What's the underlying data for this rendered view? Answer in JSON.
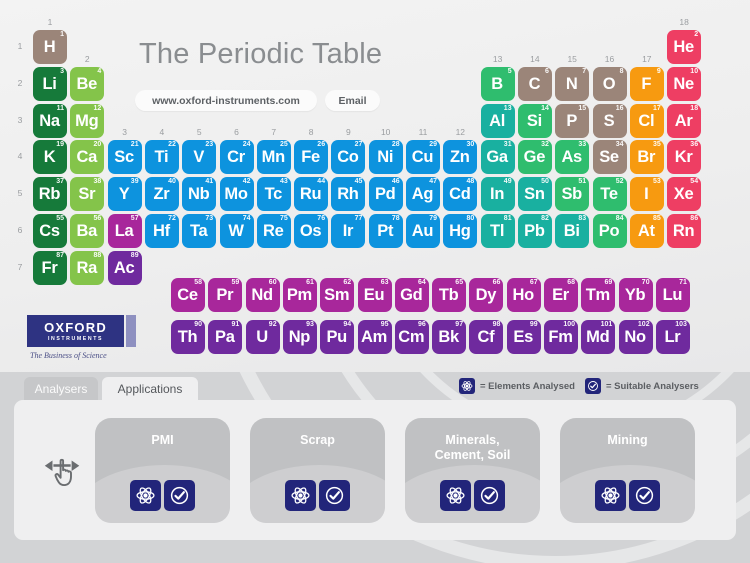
{
  "header": {
    "title": "The Periodic Table",
    "website_button": "www.oxford-instruments.com",
    "email_button": "Email"
  },
  "logo": {
    "line1": "OXFORD",
    "line2": "INSTRUMENTS",
    "tagline": "The Business of Science"
  },
  "tabs": [
    {
      "label": "Analysers",
      "active": false
    },
    {
      "label": "Applications",
      "active": true
    }
  ],
  "legend": [
    {
      "icon": "atom-icon",
      "text": "= Elements Analysed"
    },
    {
      "icon": "check-circle-icon",
      "text": "= Suitable Analysers"
    }
  ],
  "applications": [
    {
      "title": "PMI",
      "icons": [
        "atom-icon",
        "check-circle-icon"
      ]
    },
    {
      "title": "Scrap",
      "icons": [
        "atom-icon",
        "check-circle-icon"
      ]
    },
    {
      "title": "Minerals,\nCement, Soil",
      "icons": [
        "atom-icon",
        "check-circle-icon"
      ]
    },
    {
      "title": "Mining",
      "icons": [
        "atom-icon",
        "check-circle-icon"
      ]
    }
  ],
  "swipe_hint_icon": "swipe-horizontal-icon",
  "group_labels": [
    "1",
    "2",
    "3",
    "4",
    "5",
    "6",
    "7",
    "8",
    "9",
    "10",
    "11",
    "12",
    "13",
    "14",
    "15",
    "16",
    "17",
    "18"
  ],
  "period_labels": [
    "1",
    "2",
    "3",
    "4",
    "5",
    "6",
    "7"
  ],
  "colors": {
    "alkali": "#167a3a",
    "alkaline_earth": "#84c44a",
    "hydrogen": "#9b8579",
    "transition": "#0d93de",
    "post_transition": "#19b0a0",
    "metalloid": "#2fbd6e",
    "nonmetal": "#9b8579",
    "halogen": "#f79a10",
    "noble": "#ee3e63",
    "lanthanide": "#a8279b",
    "actinide": "#6f2a9e",
    "brand_navy": "#22257a"
  },
  "elements": [
    {
      "sym": "H",
      "num": "1",
      "g": 1,
      "p": 1,
      "c": "hydrogen"
    },
    {
      "sym": "He",
      "num": "2",
      "g": 18,
      "p": 1,
      "c": "noble"
    },
    {
      "sym": "Li",
      "num": "3",
      "g": 1,
      "p": 2,
      "c": "alkali"
    },
    {
      "sym": "Be",
      "num": "4",
      "g": 2,
      "p": 2,
      "c": "alkaline_earth"
    },
    {
      "sym": "B",
      "num": "5",
      "g": 13,
      "p": 2,
      "c": "metalloid"
    },
    {
      "sym": "C",
      "num": "6",
      "g": 14,
      "p": 2,
      "c": "nonmetal"
    },
    {
      "sym": "N",
      "num": "7",
      "g": 15,
      "p": 2,
      "c": "nonmetal"
    },
    {
      "sym": "O",
      "num": "8",
      "g": 16,
      "p": 2,
      "c": "nonmetal"
    },
    {
      "sym": "F",
      "num": "9",
      "g": 17,
      "p": 2,
      "c": "halogen"
    },
    {
      "sym": "Ne",
      "num": "10",
      "g": 18,
      "p": 2,
      "c": "noble"
    },
    {
      "sym": "Na",
      "num": "11",
      "g": 1,
      "p": 3,
      "c": "alkali"
    },
    {
      "sym": "Mg",
      "num": "12",
      "g": 2,
      "p": 3,
      "c": "alkaline_earth"
    },
    {
      "sym": "Al",
      "num": "13",
      "g": 13,
      "p": 3,
      "c": "post_transition"
    },
    {
      "sym": "Si",
      "num": "14",
      "g": 14,
      "p": 3,
      "c": "metalloid"
    },
    {
      "sym": "P",
      "num": "15",
      "g": 15,
      "p": 3,
      "c": "nonmetal"
    },
    {
      "sym": "S",
      "num": "16",
      "g": 16,
      "p": 3,
      "c": "nonmetal"
    },
    {
      "sym": "Cl",
      "num": "17",
      "g": 17,
      "p": 3,
      "c": "halogen"
    },
    {
      "sym": "Ar",
      "num": "18",
      "g": 18,
      "p": 3,
      "c": "noble"
    },
    {
      "sym": "K",
      "num": "19",
      "g": 1,
      "p": 4,
      "c": "alkali"
    },
    {
      "sym": "Ca",
      "num": "20",
      "g": 2,
      "p": 4,
      "c": "alkaline_earth"
    },
    {
      "sym": "Sc",
      "num": "21",
      "g": 3,
      "p": 4,
      "c": "transition"
    },
    {
      "sym": "Ti",
      "num": "22",
      "g": 4,
      "p": 4,
      "c": "transition"
    },
    {
      "sym": "V",
      "num": "23",
      "g": 5,
      "p": 4,
      "c": "transition"
    },
    {
      "sym": "Cr",
      "num": "24",
      "g": 6,
      "p": 4,
      "c": "transition"
    },
    {
      "sym": "Mn",
      "num": "25",
      "g": 7,
      "p": 4,
      "c": "transition"
    },
    {
      "sym": "Fe",
      "num": "26",
      "g": 8,
      "p": 4,
      "c": "transition"
    },
    {
      "sym": "Co",
      "num": "27",
      "g": 9,
      "p": 4,
      "c": "transition"
    },
    {
      "sym": "Ni",
      "num": "28",
      "g": 10,
      "p": 4,
      "c": "transition"
    },
    {
      "sym": "Cu",
      "num": "29",
      "g": 11,
      "p": 4,
      "c": "transition"
    },
    {
      "sym": "Zn",
      "num": "30",
      "g": 12,
      "p": 4,
      "c": "transition"
    },
    {
      "sym": "Ga",
      "num": "31",
      "g": 13,
      "p": 4,
      "c": "post_transition"
    },
    {
      "sym": "Ge",
      "num": "32",
      "g": 14,
      "p": 4,
      "c": "metalloid"
    },
    {
      "sym": "As",
      "num": "33",
      "g": 15,
      "p": 4,
      "c": "metalloid"
    },
    {
      "sym": "Se",
      "num": "34",
      "g": 16,
      "p": 4,
      "c": "nonmetal"
    },
    {
      "sym": "Br",
      "num": "35",
      "g": 17,
      "p": 4,
      "c": "halogen"
    },
    {
      "sym": "Kr",
      "num": "36",
      "g": 18,
      "p": 4,
      "c": "noble"
    },
    {
      "sym": "Rb",
      "num": "37",
      "g": 1,
      "p": 5,
      "c": "alkali"
    },
    {
      "sym": "Sr",
      "num": "38",
      "g": 2,
      "p": 5,
      "c": "alkaline_earth"
    },
    {
      "sym": "Y",
      "num": "39",
      "g": 3,
      "p": 5,
      "c": "transition"
    },
    {
      "sym": "Zr",
      "num": "40",
      "g": 4,
      "p": 5,
      "c": "transition"
    },
    {
      "sym": "Nb",
      "num": "41",
      "g": 5,
      "p": 5,
      "c": "transition"
    },
    {
      "sym": "Mo",
      "num": "42",
      "g": 6,
      "p": 5,
      "c": "transition"
    },
    {
      "sym": "Tc",
      "num": "43",
      "g": 7,
      "p": 5,
      "c": "transition"
    },
    {
      "sym": "Ru",
      "num": "44",
      "g": 8,
      "p": 5,
      "c": "transition"
    },
    {
      "sym": "Rh",
      "num": "45",
      "g": 9,
      "p": 5,
      "c": "transition"
    },
    {
      "sym": "Pd",
      "num": "46",
      "g": 10,
      "p": 5,
      "c": "transition"
    },
    {
      "sym": "Ag",
      "num": "47",
      "g": 11,
      "p": 5,
      "c": "transition"
    },
    {
      "sym": "Cd",
      "num": "48",
      "g": 12,
      "p": 5,
      "c": "transition"
    },
    {
      "sym": "In",
      "num": "49",
      "g": 13,
      "p": 5,
      "c": "post_transition"
    },
    {
      "sym": "Sn",
      "num": "50",
      "g": 14,
      "p": 5,
      "c": "post_transition"
    },
    {
      "sym": "Sb",
      "num": "51",
      "g": 15,
      "p": 5,
      "c": "metalloid"
    },
    {
      "sym": "Te",
      "num": "52",
      "g": 16,
      "p": 5,
      "c": "metalloid"
    },
    {
      "sym": "I",
      "num": "53",
      "g": 17,
      "p": 5,
      "c": "halogen"
    },
    {
      "sym": "Xe",
      "num": "54",
      "g": 18,
      "p": 5,
      "c": "noble"
    },
    {
      "sym": "Cs",
      "num": "55",
      "g": 1,
      "p": 6,
      "c": "alkali"
    },
    {
      "sym": "Ba",
      "num": "56",
      "g": 2,
      "p": 6,
      "c": "alkaline_earth"
    },
    {
      "sym": "La",
      "num": "57",
      "g": 3,
      "p": 6,
      "c": "lanthanide"
    },
    {
      "sym": "Hf",
      "num": "72",
      "g": 4,
      "p": 6,
      "c": "transition"
    },
    {
      "sym": "Ta",
      "num": "73",
      "g": 5,
      "p": 6,
      "c": "transition"
    },
    {
      "sym": "W",
      "num": "74",
      "g": 6,
      "p": 6,
      "c": "transition"
    },
    {
      "sym": "Re",
      "num": "75",
      "g": 7,
      "p": 6,
      "c": "transition"
    },
    {
      "sym": "Os",
      "num": "76",
      "g": 8,
      "p": 6,
      "c": "transition"
    },
    {
      "sym": "Ir",
      "num": "77",
      "g": 9,
      "p": 6,
      "c": "transition"
    },
    {
      "sym": "Pt",
      "num": "78",
      "g": 10,
      "p": 6,
      "c": "transition"
    },
    {
      "sym": "Au",
      "num": "79",
      "g": 11,
      "p": 6,
      "c": "transition"
    },
    {
      "sym": "Hg",
      "num": "80",
      "g": 12,
      "p": 6,
      "c": "transition"
    },
    {
      "sym": "Tl",
      "num": "81",
      "g": 13,
      "p": 6,
      "c": "post_transition"
    },
    {
      "sym": "Pb",
      "num": "82",
      "g": 14,
      "p": 6,
      "c": "post_transition"
    },
    {
      "sym": "Bi",
      "num": "83",
      "g": 15,
      "p": 6,
      "c": "post_transition"
    },
    {
      "sym": "Po",
      "num": "84",
      "g": 16,
      "p": 6,
      "c": "metalloid"
    },
    {
      "sym": "At",
      "num": "85",
      "g": 17,
      "p": 6,
      "c": "halogen"
    },
    {
      "sym": "Rn",
      "num": "86",
      "g": 18,
      "p": 6,
      "c": "noble"
    },
    {
      "sym": "Fr",
      "num": "87",
      "g": 1,
      "p": 7,
      "c": "alkali"
    },
    {
      "sym": "Ra",
      "num": "88",
      "g": 2,
      "p": 7,
      "c": "alkaline_earth"
    },
    {
      "sym": "Ac",
      "num": "89",
      "g": 3,
      "p": 7,
      "c": "actinide"
    }
  ],
  "lanthanides": [
    {
      "sym": "Ce",
      "num": "58"
    },
    {
      "sym": "Pr",
      "num": "59"
    },
    {
      "sym": "Nd",
      "num": "60"
    },
    {
      "sym": "Pm",
      "num": "61"
    },
    {
      "sym": "Sm",
      "num": "62"
    },
    {
      "sym": "Eu",
      "num": "63"
    },
    {
      "sym": "Gd",
      "num": "64"
    },
    {
      "sym": "Tb",
      "num": "65"
    },
    {
      "sym": "Dy",
      "num": "66"
    },
    {
      "sym": "Ho",
      "num": "67"
    },
    {
      "sym": "Er",
      "num": "68"
    },
    {
      "sym": "Tm",
      "num": "69"
    },
    {
      "sym": "Yb",
      "num": "70"
    },
    {
      "sym": "Lu",
      "num": "71"
    }
  ],
  "actinides": [
    {
      "sym": "Th",
      "num": "90"
    },
    {
      "sym": "Pa",
      "num": "91"
    },
    {
      "sym": "U",
      "num": "92"
    },
    {
      "sym": "Np",
      "num": "93"
    },
    {
      "sym": "Pu",
      "num": "94"
    },
    {
      "sym": "Am",
      "num": "95"
    },
    {
      "sym": "Cm",
      "num": "96"
    },
    {
      "sym": "Bk",
      "num": "97"
    },
    {
      "sym": "Cf",
      "num": "98"
    },
    {
      "sym": "Es",
      "num": "99"
    },
    {
      "sym": "Fm",
      "num": "100"
    },
    {
      "sym": "Md",
      "num": "101"
    },
    {
      "sym": "No",
      "num": "102"
    },
    {
      "sym": "Lr",
      "num": "103"
    }
  ]
}
